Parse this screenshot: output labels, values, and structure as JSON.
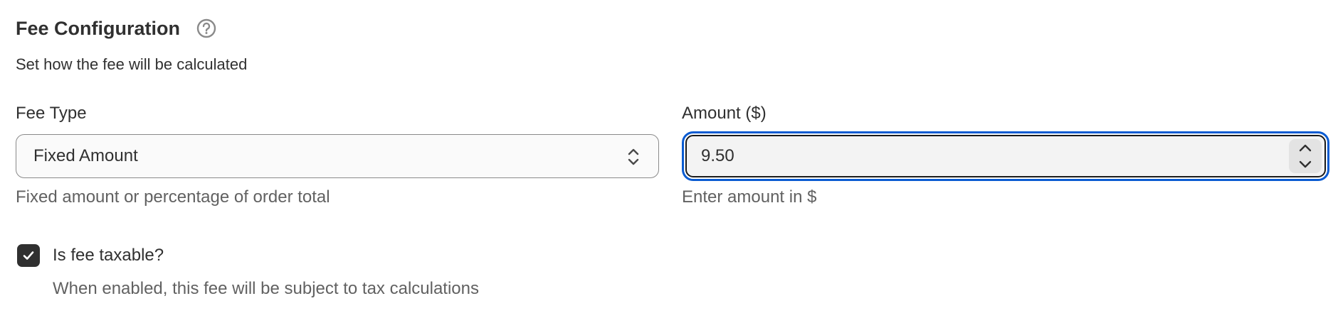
{
  "section": {
    "title": "Fee Configuration",
    "help_icon": "question-circle-icon",
    "description": "Set how the fee will be calculated"
  },
  "fee_type": {
    "label": "Fee Type",
    "selected_value": "Fixed Amount",
    "icon": "select-chevrons-icon",
    "help_text": "Fixed amount or percentage of order total"
  },
  "amount": {
    "label": "Amount ($)",
    "value": "9.50",
    "help_text": "Enter amount in $",
    "stepper_icons": [
      "chevron-up-icon",
      "chevron-down-icon"
    ],
    "focus_color": "#0a5bd1"
  },
  "taxable": {
    "label": "Is fee taxable?",
    "checked": true,
    "help_text": "When enabled, this fee will be subject to tax calculations"
  }
}
